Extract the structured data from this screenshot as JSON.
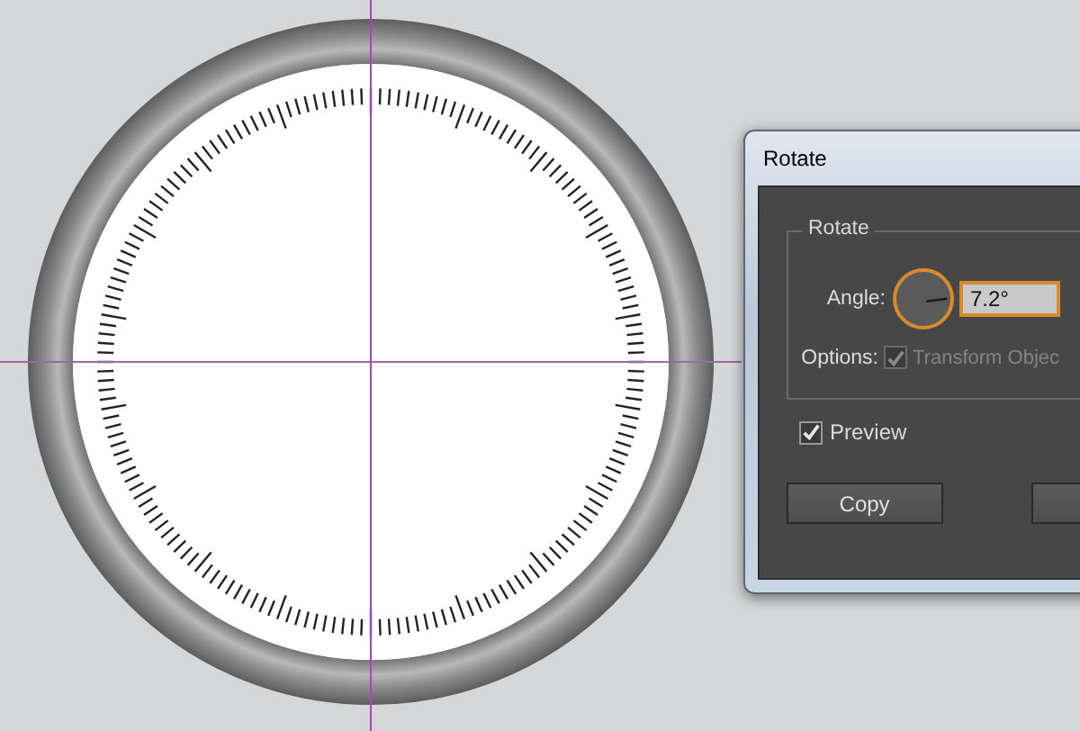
{
  "dialog": {
    "title": "Rotate",
    "group": {
      "legend": "Rotate",
      "angle_label": "Angle:",
      "angle_value": "7.2°",
      "options_label": "Options:",
      "option": {
        "label": "Transform Objec",
        "checked": true,
        "disabled": true
      }
    },
    "preview": {
      "label": "Preview",
      "checked": true
    },
    "buttons": [
      {
        "kind": "labeled",
        "label": "Copy"
      },
      {
        "kind": "blank"
      }
    ]
  }
}
